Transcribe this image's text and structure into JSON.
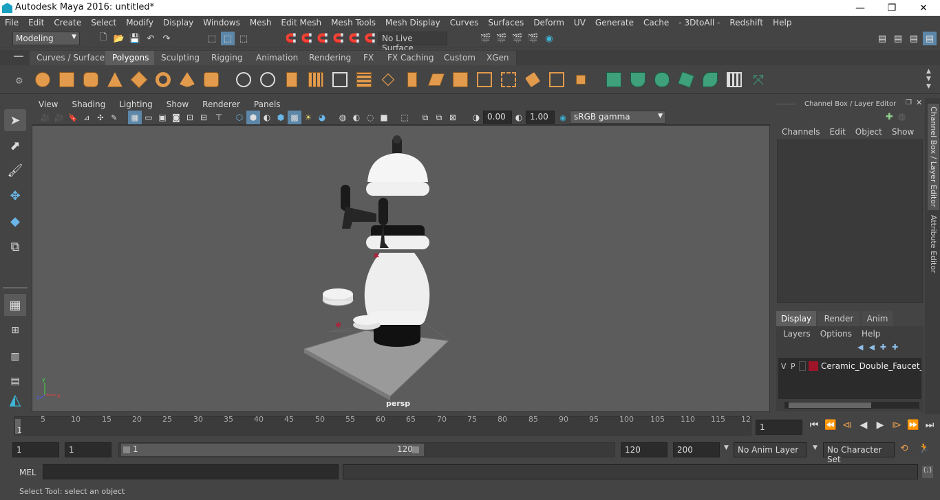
{
  "window": {
    "title": "Autodesk Maya 2016: untitled*",
    "minimize": "—",
    "restore": "❐",
    "close": "✕"
  },
  "menu": [
    "File",
    "Edit",
    "Create",
    "Select",
    "Modify",
    "Display",
    "Windows",
    "Mesh",
    "Edit Mesh",
    "Mesh Tools",
    "Mesh Display",
    "Curves",
    "Surfaces",
    "Deform",
    "UV",
    "Generate",
    "Cache",
    "- 3DtoAll -",
    "Redshift",
    "Help"
  ],
  "status": {
    "mode": "Modeling",
    "live_surface": "No Live Surface"
  },
  "shelf_tabs": [
    "Curves / Surfaces",
    "Polygons",
    "Sculpting",
    "Rigging",
    "Animation",
    "Rendering",
    "FX",
    "FX Caching",
    "Custom",
    "XGen"
  ],
  "shelf_active": "Polygons",
  "viewport": {
    "menu": [
      "View",
      "Shading",
      "Lighting",
      "Show",
      "Renderer",
      "Panels"
    ],
    "exposure": "0.00",
    "gamma": "1.00",
    "color_space": "sRGB gamma",
    "camera_label": "persp"
  },
  "channel_box": {
    "title": "Channel Box / Layer Editor",
    "menu": [
      "Channels",
      "Edit",
      "Object",
      "Show"
    ],
    "tabs": [
      "Display",
      "Render",
      "Anim"
    ],
    "active_tab": "Display",
    "layer_menu": [
      "Layers",
      "Options",
      "Help"
    ],
    "layer": {
      "v": "V",
      "p": "P",
      "name": "Ceramic_Double_Faucet_Drat",
      "color": "#a0142a"
    }
  },
  "side_tabs": [
    "Channel Box / Layer Editor",
    "Attribute Editor"
  ],
  "timeline": {
    "ticks": [
      "5",
      "10",
      "15",
      "20",
      "25",
      "30",
      "35",
      "40",
      "45",
      "50",
      "55",
      "60",
      "65",
      "70",
      "75",
      "80",
      "85",
      "90",
      "95",
      "100",
      "105",
      "110",
      "115",
      "12"
    ],
    "first_tick": "1",
    "current_frame": "1"
  },
  "range": {
    "start": "1",
    "playback_start": "1",
    "slider_start": "1",
    "slider_end": "120",
    "playback_end": "120",
    "end": "200",
    "anim_layer": "No Anim Layer",
    "character_set": "No Character Set"
  },
  "command": {
    "label": "MEL"
  },
  "help_line": "Select Tool: select an object"
}
